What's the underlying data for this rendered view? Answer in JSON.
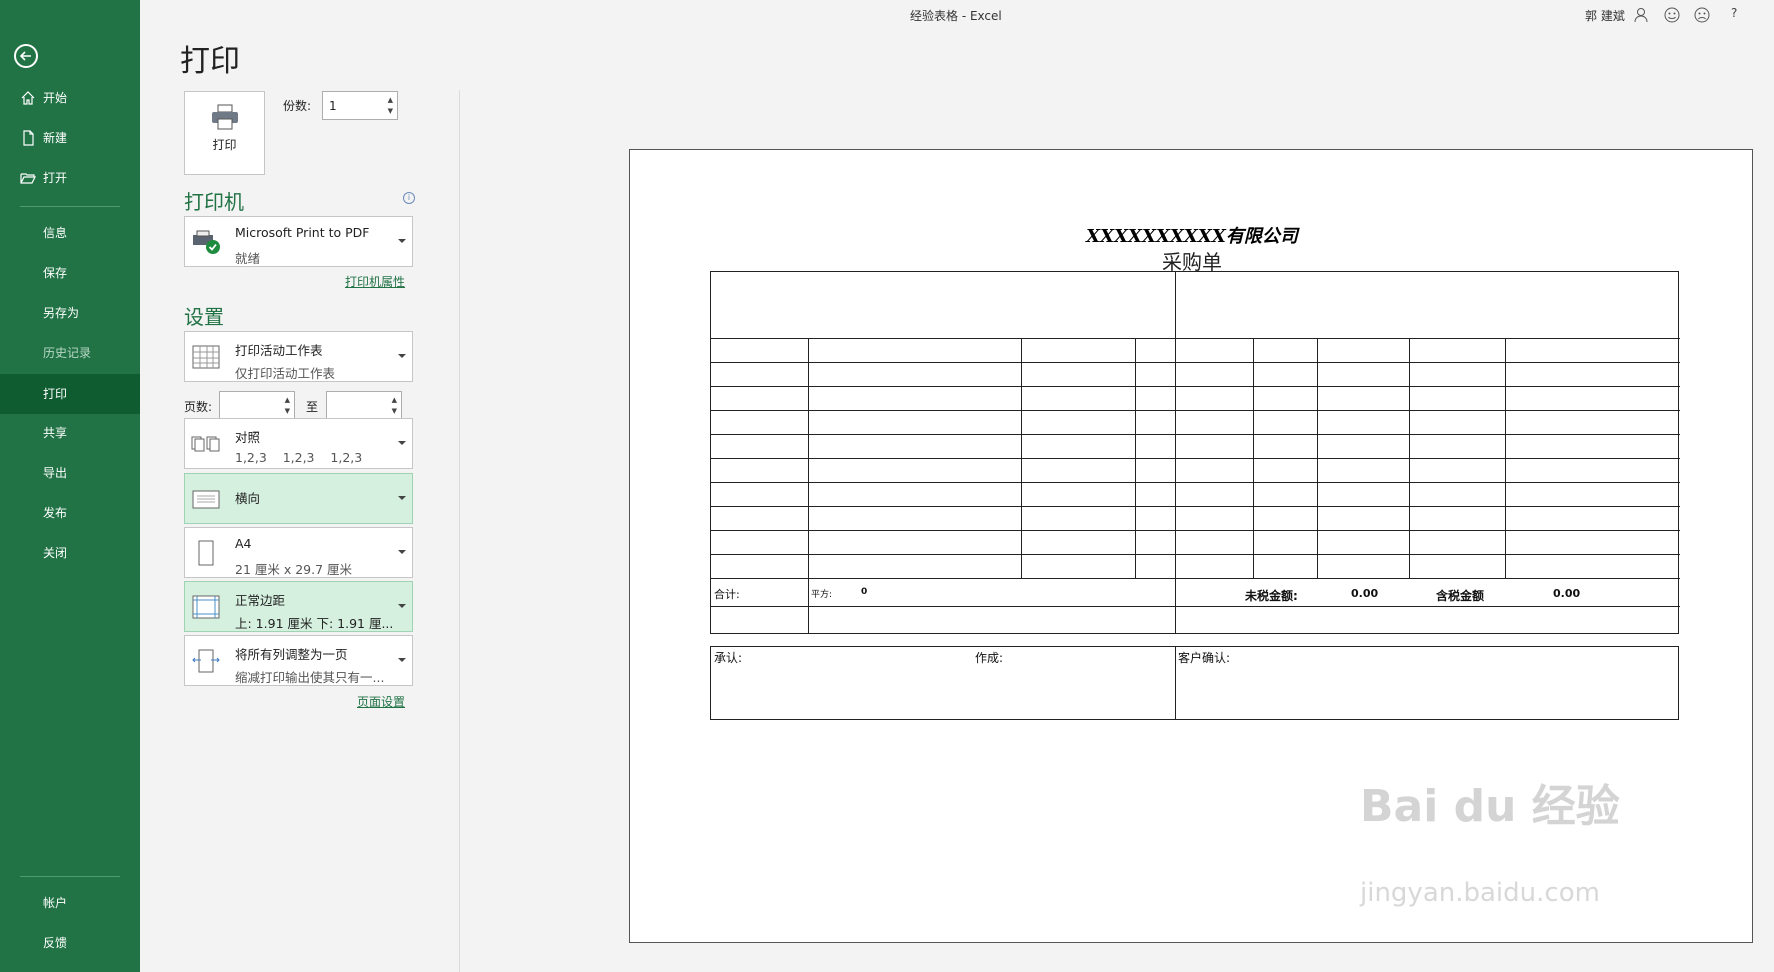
{
  "window": {
    "title": "经验表格 - Excel",
    "user": "郭 建斌"
  },
  "sidebar": {
    "items": [
      {
        "label": "开始",
        "icon": "home-icon"
      },
      {
        "label": "新建",
        "icon": "new-document-icon"
      },
      {
        "label": "打开",
        "icon": "open-folder-icon"
      },
      {
        "label": "信息"
      },
      {
        "label": "保存"
      },
      {
        "label": "另存为"
      },
      {
        "label": "历史记录"
      },
      {
        "label": "打印"
      },
      {
        "label": "共享"
      },
      {
        "label": "导出"
      },
      {
        "label": "发布"
      },
      {
        "label": "关闭"
      },
      {
        "label": "帐户"
      },
      {
        "label": "反馈"
      }
    ]
  },
  "print_panel": {
    "heading": "打印",
    "print_button_label": "打印",
    "copies_label": "份数:",
    "copies_value": "1",
    "printer_section": "打印机",
    "printer_name": "Microsoft Print to PDF",
    "printer_status": "就绪",
    "printer_properties_link": "打印机属性",
    "settings_section": "设置",
    "what_to_print": {
      "title": "打印活动工作表",
      "subtitle": "仅打印活动工作表"
    },
    "pages_label": "页数:",
    "to_label": "至",
    "collation": {
      "title": "对照",
      "subtitle": "1,2,3    1,2,3    1,2,3"
    },
    "orientation": {
      "title": "横向"
    },
    "paper": {
      "title": "A4",
      "subtitle": "21 厘米 x 29.7 厘米"
    },
    "margins": {
      "title": "正常边距",
      "subtitle": "上: 1.91 厘米 下: 1.91 厘..."
    },
    "scaling": {
      "title": "将所有列调整为一页",
      "subtitle": "缩减打印输出使其只有一..."
    },
    "page_setup_link": "页面设置"
  },
  "preview": {
    "company": "XXXXXXXXXX有限公司",
    "doc_title": "采购单",
    "total_label": "合计:",
    "area_label": "平方:",
    "area_value": "0",
    "pretax_label": "未税金额:",
    "pretax_value": "0.00",
    "tax_label": "含税金额",
    "tax_value": "0.00",
    "approve_label": "承认:",
    "made_label": "作成:",
    "customer_label": "客户确认:"
  },
  "watermark": {
    "text": "Bai du 经验",
    "url_text": "jingyan.baidu.com"
  },
  "colors": {
    "sidebar": "#217346",
    "sidebar_active": "#0f5c30",
    "accent": "#217346",
    "highlight": "#d6f0e0"
  }
}
